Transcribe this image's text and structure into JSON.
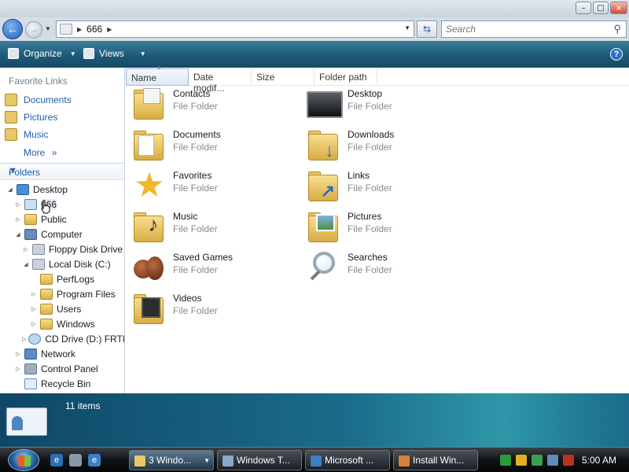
{
  "window": {
    "controls": [
      "–",
      "□",
      "×"
    ]
  },
  "nav": {
    "address_crumb": "666",
    "search_placeholder": "Search"
  },
  "toolbar": {
    "organize_label": "Organize",
    "views_label": "Views",
    "help_label": "?"
  },
  "favorites": {
    "title": "Favorite Links",
    "items": [
      {
        "label": "Documents",
        "icon": "documents-folder-icon"
      },
      {
        "label": "Pictures",
        "icon": "pictures-folder-icon"
      },
      {
        "label": "Music",
        "icon": "music-folder-icon"
      }
    ],
    "more_label": "More",
    "more_glyph": "»"
  },
  "folders_pane": {
    "title": "Folders",
    "tree": [
      {
        "label": "Desktop",
        "icon": "desktop-icon",
        "arrow": "◢"
      },
      {
        "label": "666",
        "icon": "user-folder-icon",
        "arrow": "▷",
        "selected": true
      },
      {
        "label": "Public",
        "icon": "folder-icon",
        "arrow": "▷"
      },
      {
        "label": "Computer",
        "icon": "computer-icon",
        "arrow": "◢"
      },
      {
        "label": "Floppy Disk Drive",
        "icon": "floppy-drive-icon",
        "arrow": "▷"
      },
      {
        "label": "Local Disk (C:)",
        "icon": "local-disk-icon",
        "arrow": "◢"
      },
      {
        "label": "PerfLogs",
        "icon": "folder-icon",
        "arrow": ""
      },
      {
        "label": "Program Files",
        "icon": "folder-icon",
        "arrow": "▷"
      },
      {
        "label": "Users",
        "icon": "folder-icon",
        "arrow": "▷"
      },
      {
        "label": "Windows",
        "icon": "folder-icon",
        "arrow": "▷"
      },
      {
        "label": "CD Drive (D:) FRTM",
        "icon": "cd-drive-icon",
        "arrow": "▷"
      },
      {
        "label": "Network",
        "icon": "network-icon",
        "arrow": "▷"
      },
      {
        "label": "Control Panel",
        "icon": "control-panel-icon",
        "arrow": "▷"
      },
      {
        "label": "Recycle Bin",
        "icon": "recycle-bin-icon",
        "arrow": ""
      }
    ]
  },
  "columns": [
    "Name",
    "Date modif...",
    "Size",
    "Folder path"
  ],
  "sort_glyph": "▲",
  "items": [
    {
      "name": "Contacts",
      "type": "File Folder",
      "icon": "contacts-folder-icon"
    },
    {
      "name": "Desktop",
      "type": "File Folder",
      "icon": "desktop-folder-icon"
    },
    {
      "name": "Documents",
      "type": "File Folder",
      "icon": "documents-folder-icon"
    },
    {
      "name": "Downloads",
      "type": "File Folder",
      "icon": "downloads-folder-icon"
    },
    {
      "name": "Favorites",
      "type": "File Folder",
      "icon": "favorites-star-icon"
    },
    {
      "name": "Links",
      "type": "File Folder",
      "icon": "links-folder-icon"
    },
    {
      "name": "Music",
      "type": "File Folder",
      "icon": "music-folder-icon"
    },
    {
      "name": "Pictures",
      "type": "File Folder",
      "icon": "pictures-folder-icon"
    },
    {
      "name": "Saved Games",
      "type": "File Folder",
      "icon": "saved-games-icon"
    },
    {
      "name": "Searches",
      "type": "File Folder",
      "icon": "searches-magnifier-icon"
    },
    {
      "name": "Videos",
      "type": "File Folder",
      "icon": "videos-folder-icon"
    }
  ],
  "details": {
    "item_count": "11 items"
  },
  "taskbar": {
    "tasks": [
      {
        "label": "3 Windo...",
        "icon": "explorer-folder-icon",
        "active": true
      },
      {
        "label": "Windows T...",
        "icon": "windows-task-icon",
        "active": false
      },
      {
        "label": "Microsoft ...",
        "icon": "internet-explorer-icon",
        "active": false
      },
      {
        "label": "Install Win...",
        "icon": "install-windows-icon",
        "active": false
      }
    ],
    "clock": "5:00 AM"
  },
  "colors": {
    "toolbar": "#1d5a78",
    "link_blue": "#1e5fad",
    "details_pane": "#1a6c8a",
    "folder_yellow": "#e9c763"
  }
}
